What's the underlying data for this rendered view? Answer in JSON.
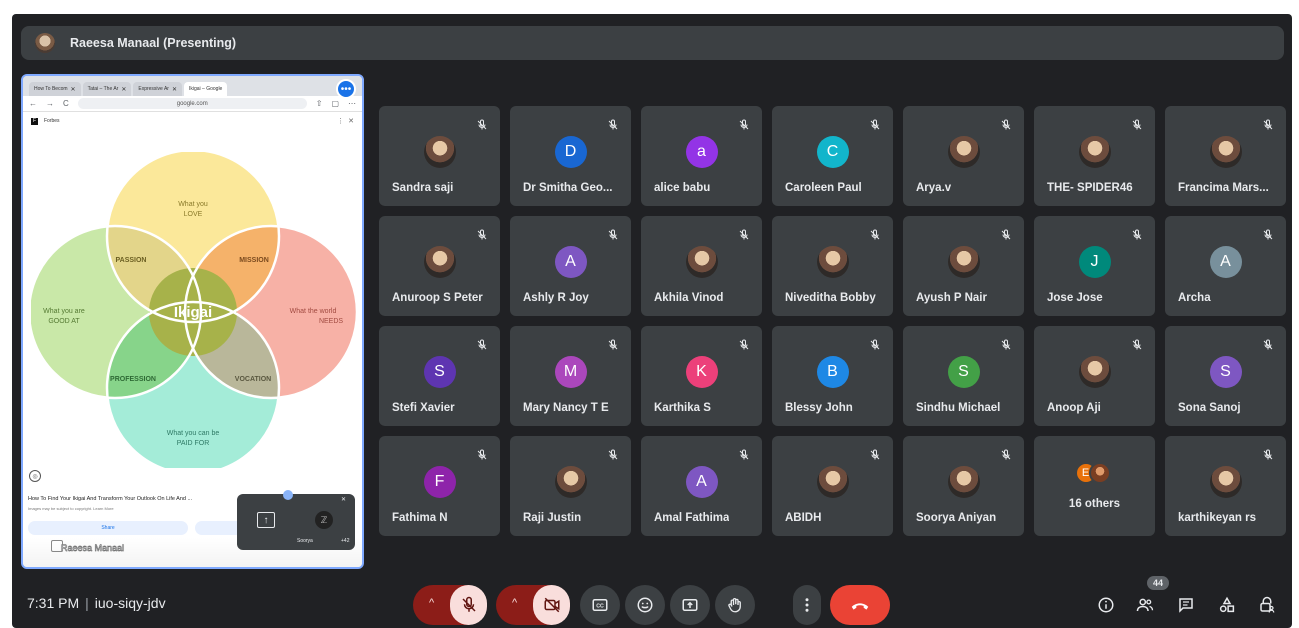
{
  "presenter": {
    "label": "Raeesa Manaal (Presenting)"
  },
  "screen_share": {
    "browser_tabs": [
      "How To Becom",
      "Tatai – The Ar",
      "Expressive Ar",
      "Ikigai – Google"
    ],
    "url": "google.com",
    "site_header": "Forbes",
    "venn": {
      "top": [
        "What you",
        "LOVE"
      ],
      "left": [
        "What you are",
        "GOOD AT"
      ],
      "right": [
        "What the world",
        "NEEDS"
      ],
      "bottom": [
        "What you can be",
        "PAID FOR"
      ],
      "passion": "PASSION",
      "mission": "MISSION",
      "profession": "PROFESSION",
      "vocation": "VOCATION",
      "center": "Ikigai",
      "colors": {
        "top": "#fbe89a",
        "left": "#c9e8a8",
        "right": "#f7b1a6",
        "bottom": "#a4ecd8",
        "passion": "#e3d58a",
        "mission": "#f5b26a",
        "profession": "#87d48a",
        "vocation": "#b9b79a",
        "center": "#a7b24a"
      }
    },
    "caption": "How To Find Your Ikigai And Transform Your Outlook On Life And ...",
    "caption_sub": "Images may be subject to copyright. Learn More",
    "share_label": "Share",
    "self_view_name": "Raeesa Manaal",
    "mini_tile_name": "Soorya",
    "mini_tile_count": "+42"
  },
  "participants": [
    {
      "name": "Sandra saji",
      "avatar": "photo"
    },
    {
      "name": "Dr Smitha Geo...",
      "avatar": "D",
      "color": "#1967d2"
    },
    {
      "name": "alice babu",
      "avatar": "a",
      "color": "#9334e6"
    },
    {
      "name": "Caroleen Paul",
      "avatar": "C",
      "color": "#12b5cb"
    },
    {
      "name": "Arya.v",
      "avatar": "photo"
    },
    {
      "name": "THE- SPIDER46",
      "avatar": "photo"
    },
    {
      "name": "Francima Mars...",
      "avatar": "photo"
    },
    {
      "name": "Anuroop S Peter",
      "avatar": "photo"
    },
    {
      "name": "Ashly R Joy",
      "avatar": "A",
      "color": "#7e57c2"
    },
    {
      "name": "Akhila Vinod",
      "avatar": "photo"
    },
    {
      "name": "Niveditha Bobby",
      "avatar": "photo"
    },
    {
      "name": "Ayush P Nair",
      "avatar": "photo"
    },
    {
      "name": "Jose Jose",
      "avatar": "J",
      "color": "#00897b"
    },
    {
      "name": "Archa",
      "avatar": "A",
      "color": "#78909c"
    },
    {
      "name": "Stefi Xavier",
      "avatar": "S",
      "color": "#5e35b1"
    },
    {
      "name": "Mary Nancy T E",
      "avatar": "M",
      "color": "#ab47bc"
    },
    {
      "name": "Karthika S",
      "avatar": "K",
      "color": "#ec407a"
    },
    {
      "name": "Blessy John",
      "avatar": "B",
      "color": "#1e88e5"
    },
    {
      "name": "Sindhu Michael",
      "avatar": "S",
      "color": "#43a047"
    },
    {
      "name": "Anoop Aji",
      "avatar": "photo"
    },
    {
      "name": "Sona Sanoj",
      "avatar": "S",
      "color": "#7e57c2"
    },
    {
      "name": "Fathima N",
      "avatar": "F",
      "color": "#8e24aa"
    },
    {
      "name": "Raji Justin",
      "avatar": "photo"
    },
    {
      "name": "Amal Fathima",
      "avatar": "A",
      "color": "#7e57c2"
    },
    {
      "name": "ABIDH",
      "avatar": "photo"
    },
    {
      "name": "Soorya Aniyan",
      "avatar": "photo"
    },
    {
      "name": "16 others",
      "avatar": "others",
      "initial": "E"
    },
    {
      "name": "karthikeyan rs",
      "avatar": "photo"
    }
  ],
  "footer": {
    "time": "7:31 PM",
    "meeting_code": "iuo-siqy-jdv",
    "people_count": "44"
  },
  "colors": {
    "background": "#202124",
    "tile": "#3c4043",
    "mic_off_bg": "#f9dedc",
    "mic_off_group": "#8c1d18",
    "end_call": "#ea4335",
    "presentation_border": "#7fa9ff"
  }
}
